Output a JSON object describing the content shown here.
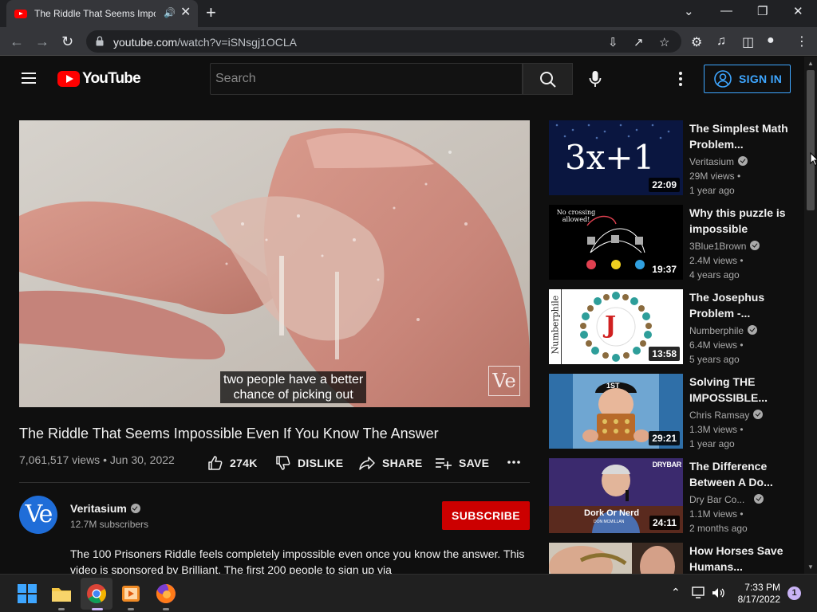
{
  "browser": {
    "tab_title": "The Riddle That Seems Impo",
    "url_host": "youtube.com",
    "url_path": "/watch?v=iSNsgj1OCLA"
  },
  "masthead": {
    "logo_text": "YouTube",
    "search_placeholder": "Search",
    "signin_label": "SIGN IN"
  },
  "player": {
    "caption_line1": "two people have a better",
    "caption_line2": "chance of picking out",
    "watermark": "Ve"
  },
  "video": {
    "title": "The Riddle That Seems Impossible Even If You Know The Answer",
    "meta": "7,061,517 views • Jun 30, 2022",
    "likes": "274K",
    "dislike_label": "DISLIKE",
    "share_label": "SHARE",
    "save_label": "SAVE"
  },
  "channel": {
    "avatar_text": "Ve",
    "name": "Veritasium",
    "subscribers": "12.7M subscribers",
    "subscribe_label": "SUBSCRIBE"
  },
  "description": {
    "line1": "The 100 Prisoners Riddle feels completely impossible even once you know the answer. This",
    "line2": "video is sponsored by Brilliant. The first 200 people to sign up via"
  },
  "recommendations": [
    {
      "title": "The Simplest Math Problem...",
      "channel": "Veritasium",
      "views": "29M views •",
      "age": "1 year ago",
      "duration": "22:09",
      "thumb_text": "3x+1"
    },
    {
      "title": "Why this puzzle is impossible",
      "channel": "3Blue1Brown",
      "views": "2.4M views •",
      "age": "4 years ago",
      "duration": "19:37",
      "thumb_text": "No crossing allowed!"
    },
    {
      "title": "The Josephus Problem -...",
      "channel": "Numberphile",
      "views": "6.4M views •",
      "age": "5 years ago",
      "duration": "13:58",
      "thumb_text": "J",
      "thumb_side": "Numberphile"
    },
    {
      "title": "Solving THE IMPOSSIBLE...",
      "channel": "Chris Ramsay",
      "views": "1.3M views •",
      "age": "1 year ago",
      "duration": "29:21",
      "thumb_text": "1ST"
    },
    {
      "title": "The Difference Between A Do...",
      "channel": "Dry Bar Co...",
      "views": "1.1M views •",
      "age": "2 months ago",
      "duration": "24:11",
      "thumb_text": "Dork Or Nerd",
      "thumb_sub": "DON MCMILLAN",
      "thumb_brand": "DRYBAR"
    },
    {
      "title": "How Horses Save Humans..."
    }
  ],
  "taskbar": {
    "time": "7:33 PM",
    "date": "8/17/2022",
    "notifications": "1"
  },
  "colors": {
    "background": "#0f0f0f",
    "accent_blue": "#3ea6ff",
    "subscribe_red": "#cc0000",
    "youtube_red": "#ff0000"
  }
}
